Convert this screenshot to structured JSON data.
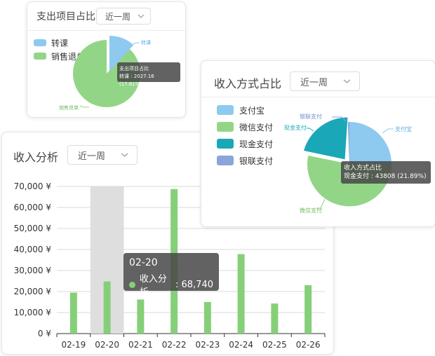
{
  "expense_card": {
    "title": "支出项目占比",
    "period": "近一周",
    "legend": [
      {
        "label": "转课",
        "color": "#8ec9ef"
      },
      {
        "label": "销售退单",
        "color": "#93d587"
      }
    ],
    "slice_labels": [
      "转课",
      "销售退单"
    ],
    "tooltip": {
      "title": "支出项目占比",
      "line": "转课 : 2027.16 (17.61%)"
    }
  },
  "payment_card": {
    "title": "收入方式占比",
    "period": "近一周",
    "legend": [
      {
        "label": "支付宝",
        "color": "#8ec9ef"
      },
      {
        "label": "微信支付",
        "color": "#93d587"
      },
      {
        "label": "现金支付",
        "color": "#1aa8b8"
      },
      {
        "label": "银联支付",
        "color": "#8aa6d8"
      }
    ],
    "slice_labels": [
      "银联支付",
      "现金支付",
      "支付宝",
      "微信支付"
    ],
    "tooltip": {
      "title": "收入方式占比",
      "line": "现金支付 : 43808 (21.89%)"
    }
  },
  "income_card": {
    "title": "收入分析",
    "period": "近一周",
    "tooltip": {
      "date": "02-20",
      "series": "收入分析",
      "value": "68,740"
    }
  },
  "chart_data": [
    {
      "type": "pie",
      "title": "支出项目占比",
      "labels": [
        "转课",
        "销售退单"
      ],
      "values": [
        17.61,
        82.39
      ],
      "colors": [
        "#8ec9ef",
        "#93d587"
      ]
    },
    {
      "type": "pie",
      "title": "收入方式占比",
      "labels": [
        "支付宝",
        "微信支付",
        "现金支付",
        "银联支付"
      ],
      "values": [
        20.5,
        57.0,
        21.89,
        0.61
      ],
      "colors": [
        "#8ec9ef",
        "#93d587",
        "#1aa8b8",
        "#8aa6d8"
      ]
    },
    {
      "type": "bar",
      "title": "收入分析",
      "categories": [
        "02-19",
        "02-20",
        "02-21",
        "02-22",
        "02-23",
        "02-24",
        "02-25",
        "02-26"
      ],
      "series": [
        {
          "name": "收入分析",
          "values": [
            19500,
            24800,
            16200,
            68740,
            15000,
            37800,
            14300,
            23000
          ]
        }
      ],
      "ylim": [
        0,
        70000
      ],
      "yticks": [
        "0 ¥",
        "10,000 ¥",
        "20,000 ¥",
        "30,000 ¥",
        "40,000 ¥",
        "50,000 ¥",
        "60,000 ¥",
        "70,000 ¥"
      ],
      "highlight_category": "02-20",
      "grid": true,
      "bar_color": "#86cf79"
    }
  ]
}
